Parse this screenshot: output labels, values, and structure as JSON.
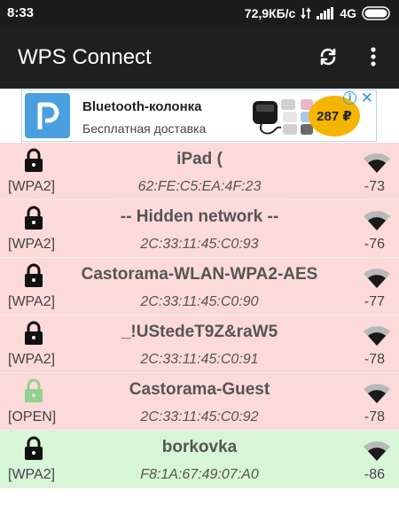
{
  "status_bar": {
    "time": "8:33",
    "network_speed": "72,9КБ/с",
    "network_type": "4G"
  },
  "app_bar": {
    "title": "WPS Connect",
    "refresh_icon": "refresh-icon",
    "menu_icon": "more-vert-icon"
  },
  "ad": {
    "title": "Bluetooth-колонка",
    "subtitle": "Бесплатная доставка",
    "price": "287 ₽",
    "accent_color": "#f5b400"
  },
  "networks": [
    {
      "ssid": "iPad (",
      "bssid": "62:FE:C5:EA:4F:23",
      "security": "[WPA2]",
      "rssi": "-73",
      "locked": true
    },
    {
      "ssid": "-- Hidden network --",
      "bssid": "2C:33:11:45:C0:93",
      "security": "[WPA2]",
      "rssi": "-76",
      "locked": true
    },
    {
      "ssid": "Castorama-WLAN-WPA2-AES",
      "bssid": "2C:33:11:45:C0:90",
      "security": "[WPA2]",
      "rssi": "-77",
      "locked": true
    },
    {
      "ssid": "_!UStedeT9Z&raW5",
      "bssid": "2C:33:11:45:C0:91",
      "security": "[WPA2]",
      "rssi": "-78",
      "locked": true
    },
    {
      "ssid": "Castorama-Guest",
      "bssid": "2C:33:11:45:C0:92",
      "security": "[OPEN]",
      "rssi": "-78",
      "locked": false
    },
    {
      "ssid": "borkovka",
      "bssid": "F8:1A:67:49:07:A0",
      "security": "[WPA2]",
      "rssi": "-86",
      "locked": true
    }
  ],
  "colors": {
    "row_red": "#fddada",
    "row_green": "#d7f5d7",
    "open_lock": "#8ed38e"
  }
}
